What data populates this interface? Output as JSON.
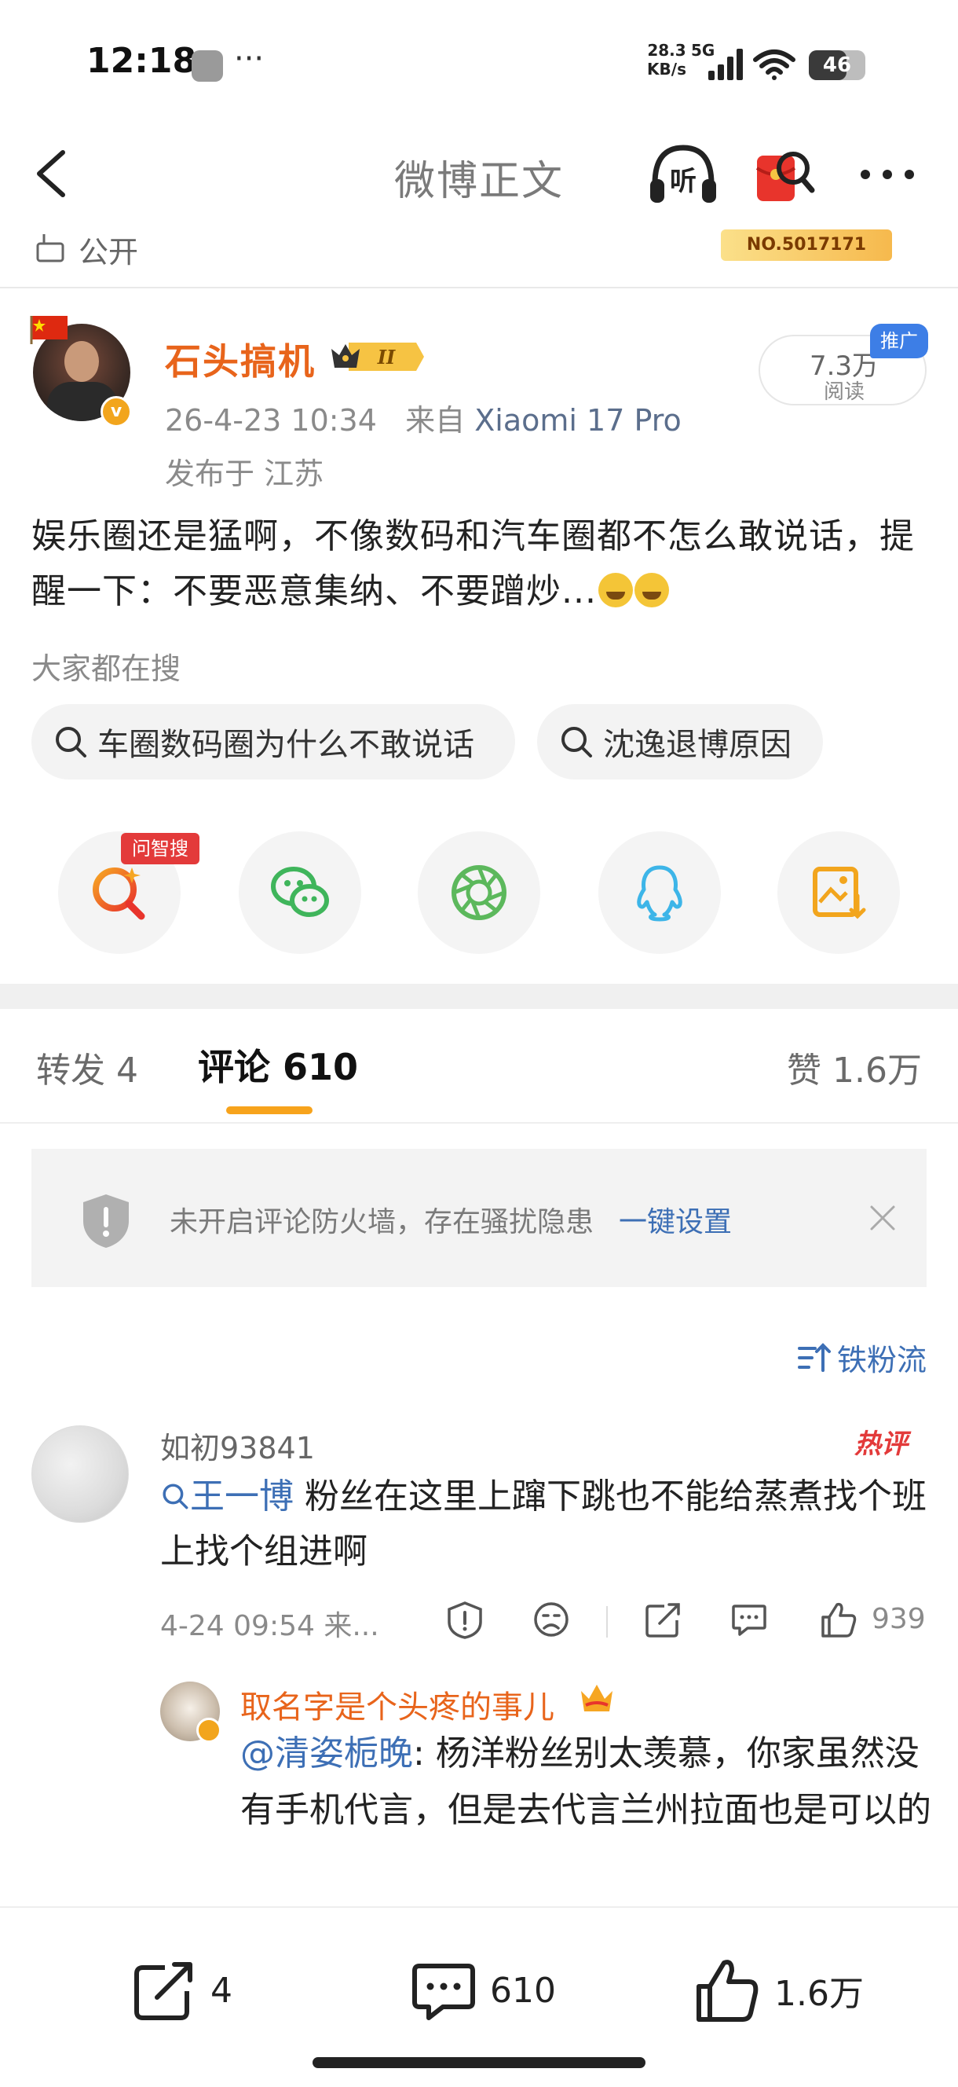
{
  "status_bar": {
    "time": "12:18",
    "more": "···",
    "net_speed_value": "28.3",
    "net_speed_unit": "KB/s",
    "network": "5G",
    "battery": "46"
  },
  "nav": {
    "title": "微博正文"
  },
  "prev_strip": {
    "visibility": "公开",
    "badge": "NO.5017171"
  },
  "post": {
    "username": "石头搞机",
    "date": "26-4-23 10:34",
    "from_label": "来自",
    "device": "Xiaomi 17 Pro",
    "location": "发布于  江苏",
    "reads_count": "7.3万",
    "reads_label": "阅读",
    "promo_tag": "推广",
    "text": "娱乐圈还是猛啊，不像数码和汽车圈都不怎么敢说话，提醒一下：不要恶意集纳、不要蹭炒..."
  },
  "search": {
    "label": "大家都在搜",
    "chips": [
      "车圈数码圈为什么不敢说话",
      "沈逸退博原因"
    ]
  },
  "share": {
    "ai_tag": "问智搜"
  },
  "tabs": {
    "repost": "转发 4",
    "comment": "评论 610",
    "likes": "赞 1.6万"
  },
  "notice": {
    "text": "未开启评论防火墙，存在骚扰隐患",
    "link": "一键设置"
  },
  "sort": {
    "label": "铁粉流"
  },
  "comment1": {
    "name": "如初93841",
    "hot_tag": "热评",
    "topic": "王一博",
    "text": " 粉丝在这里上蹿下跳也不能给蒸煮找个班上找个组进啊",
    "time": "4-24 09:54  来...",
    "like_count": "939"
  },
  "reply1": {
    "name": "取名字是个头疼的事儿",
    "mention": "@清姿栀晚",
    "text": ": 杨洋粉丝别太羡慕，你家虽然没有手机代言，但是去代言兰州拉面也是可以的"
  },
  "bottom_bar": {
    "repost": "4",
    "comment": "610",
    "like": "1.6万"
  },
  "colors": {
    "username": "#e8641b",
    "link": "#3d6fb5",
    "accent": "#f7a31c",
    "hot": "#e33a3a"
  }
}
